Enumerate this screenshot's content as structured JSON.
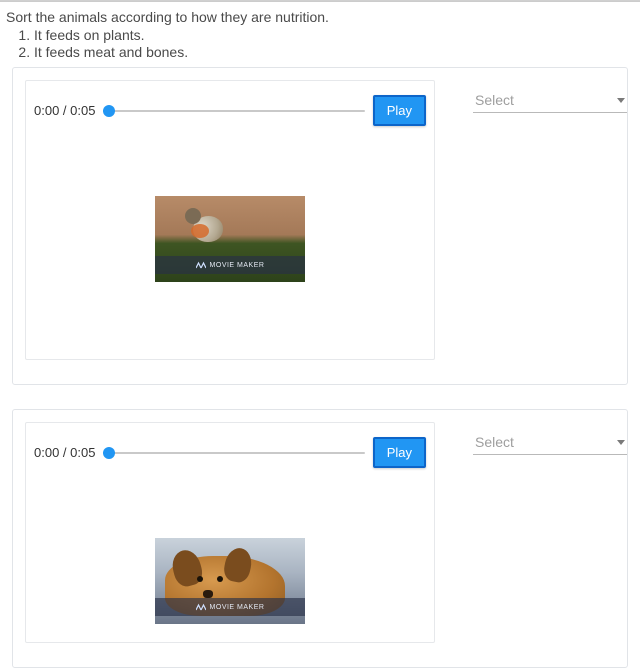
{
  "question": "Sort the animals according to how they are nutrition.",
  "options": [
    "It feeds on plants.",
    "It feeds meat and bones."
  ],
  "watermark": "MOVIE MAKER",
  "items": [
    {
      "time": "0:00 / 0:05",
      "play_label": "Play",
      "select_placeholder": "Select",
      "thumb_kind": "bird"
    },
    {
      "time": "0:00 / 0:05",
      "play_label": "Play",
      "select_placeholder": "Select",
      "thumb_kind": "dog"
    }
  ]
}
